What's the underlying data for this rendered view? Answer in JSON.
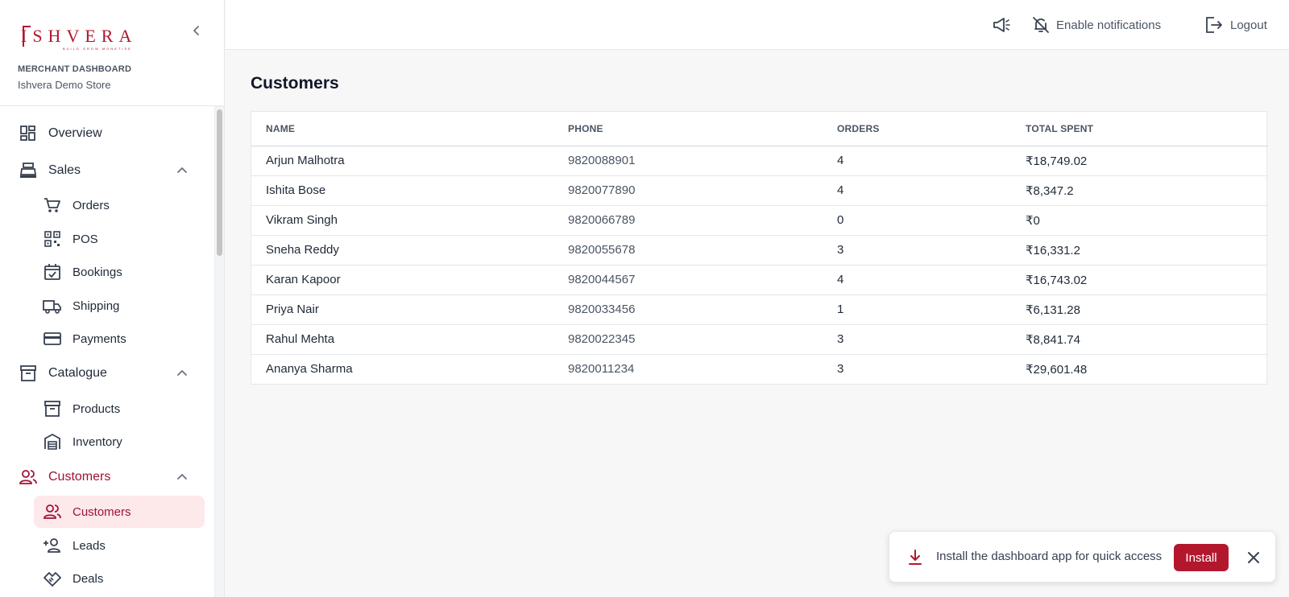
{
  "brand": {
    "logo_text": "ISHVERA",
    "logo_tagline": "BUILD GROW MONETISE",
    "dashboard_label": "MERCHANT DASHBOARD",
    "store_name": "Ishvera Demo Store",
    "accent_color": "#b3172e"
  },
  "sidebar": {
    "overview": {
      "label": "Overview",
      "icon": "dashboard-icon"
    },
    "sales": {
      "label": "Sales",
      "icon": "cash-register-icon",
      "items": [
        {
          "label": "Orders",
          "icon": "cart-icon"
        },
        {
          "label": "POS",
          "icon": "qr-code-icon"
        },
        {
          "label": "Bookings",
          "icon": "calendar-check-icon"
        },
        {
          "label": "Shipping",
          "icon": "truck-icon"
        },
        {
          "label": "Payments",
          "icon": "credit-card-icon"
        }
      ]
    },
    "catalogue": {
      "label": "Catalogue",
      "icon": "archive-icon",
      "items": [
        {
          "label": "Products",
          "icon": "archive-icon"
        },
        {
          "label": "Inventory",
          "icon": "warehouse-icon"
        }
      ]
    },
    "customers": {
      "label": "Customers",
      "icon": "users-icon",
      "items": [
        {
          "label": "Customers",
          "icon": "users-icon"
        },
        {
          "label": "Leads",
          "icon": "user-plus-icon"
        },
        {
          "label": "Deals",
          "icon": "handshake-icon"
        }
      ]
    }
  },
  "topbar": {
    "announcement_icon": "megaphone-icon",
    "notifications_label": "Enable notifications",
    "logout_label": "Logout"
  },
  "main": {
    "title": "Customers",
    "columns": [
      "NAME",
      "PHONE",
      "ORDERS",
      "TOTAL SPENT"
    ],
    "rows": [
      {
        "name": "Arjun Malhotra",
        "phone": "9820088901",
        "orders": "4",
        "total": "₹18,749.02"
      },
      {
        "name": "Ishita Bose",
        "phone": "9820077890",
        "orders": "4",
        "total": "₹8,347.2"
      },
      {
        "name": "Vikram Singh",
        "phone": "9820066789",
        "orders": "0",
        "total": "₹0"
      },
      {
        "name": "Sneha Reddy",
        "phone": "9820055678",
        "orders": "3",
        "total": "₹16,331.2"
      },
      {
        "name": "Karan Kapoor",
        "phone": "9820044567",
        "orders": "4",
        "total": "₹16,743.02"
      },
      {
        "name": "Priya Nair",
        "phone": "9820033456",
        "orders": "1",
        "total": "₹6,131.28"
      },
      {
        "name": "Rahul Mehta",
        "phone": "9820022345",
        "orders": "3",
        "total": "₹8,841.74"
      },
      {
        "name": "Ananya Sharma",
        "phone": "9820011234",
        "orders": "3",
        "total": "₹29,601.48"
      }
    ]
  },
  "toast": {
    "message": "Install the dashboard app for quick access",
    "install_label": "Install"
  }
}
